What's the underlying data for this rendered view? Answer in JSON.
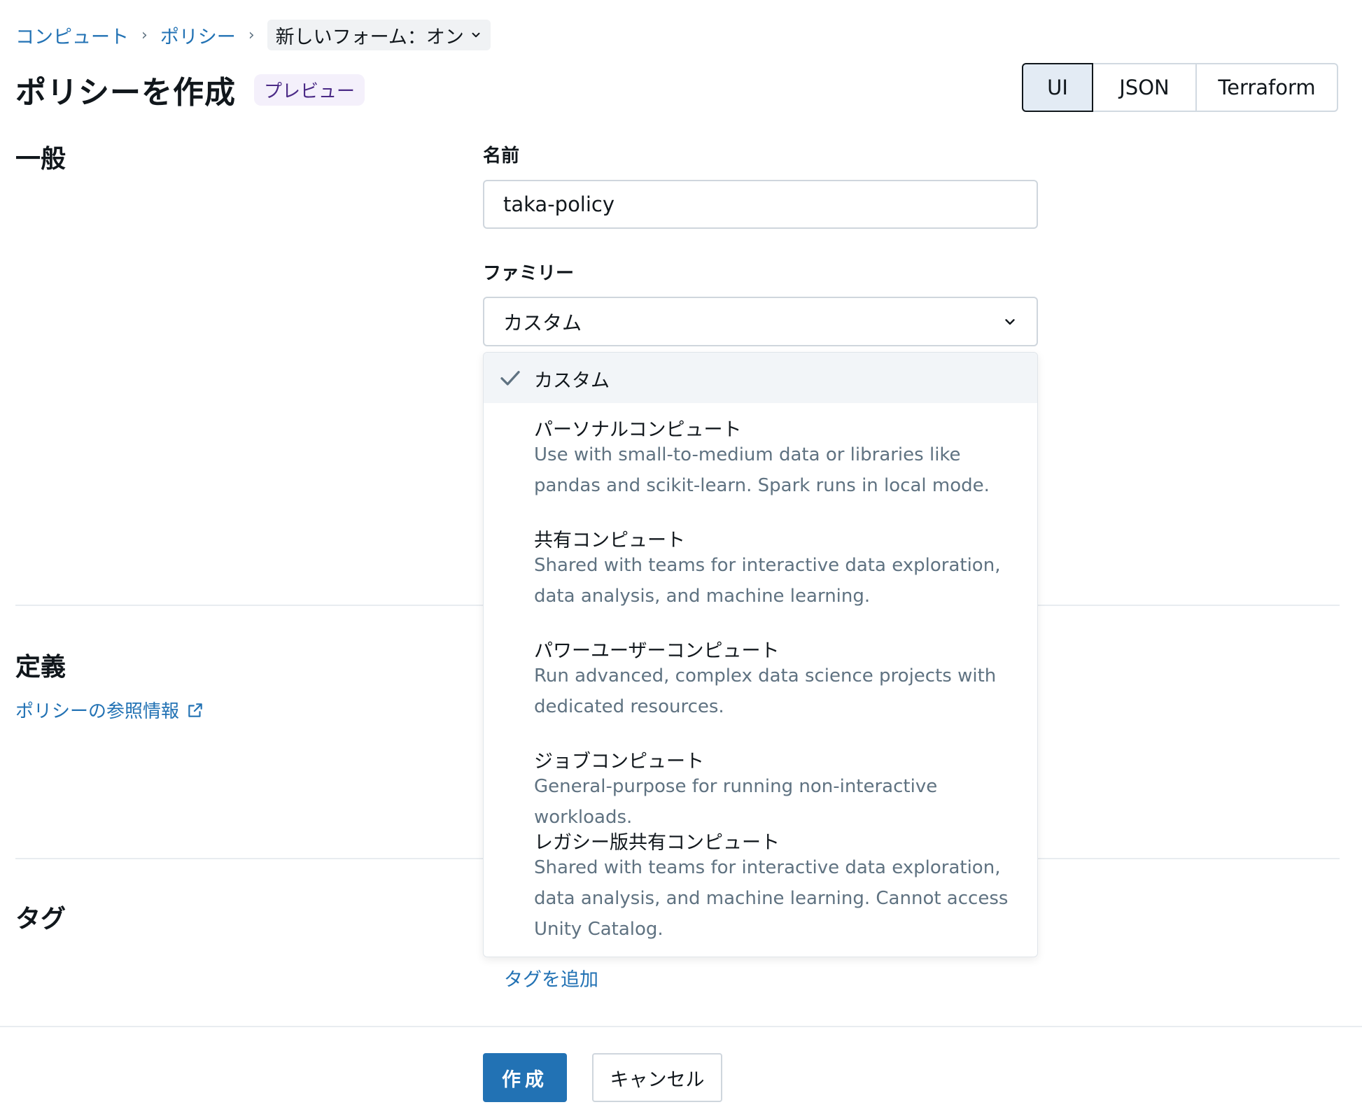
{
  "breadcrumb": {
    "items": [
      "コンピュート",
      "ポリシー"
    ],
    "current": "新しいフォーム：オン"
  },
  "header": {
    "title": "ポリシーを作成",
    "badge": "プレビュー",
    "view_tabs": [
      "UI",
      "JSON",
      "Terraform"
    ],
    "active_tab": "UI"
  },
  "sections": {
    "general": "一般",
    "definition": "定義",
    "definition_link": "ポリシーの参照情報",
    "tags": "タグ"
  },
  "form": {
    "name_label": "名前",
    "name_value": "taka-policy",
    "family_label": "ファミリー",
    "family_value": "カスタム"
  },
  "dropdown": {
    "options": [
      {
        "title": "カスタム",
        "desc": ""
      },
      {
        "title": "パーソナルコンピュート",
        "desc": "Use with small-to-medium data or libraries like pandas and scikit-learn. Spark runs in local mode."
      },
      {
        "title": "共有コンピュート",
        "desc": "Shared with teams for interactive data exploration, data analysis, and machine learning."
      },
      {
        "title": "パワーユーザーコンピュート",
        "desc": "Run advanced, complex data science projects with dedicated resources."
      },
      {
        "title": "ジョブコンピュート",
        "desc": "General-purpose for running non-interactive workloads."
      },
      {
        "title": "レガシー版共有コンピュート",
        "desc": "Shared with teams for interactive data exploration, data analysis, and machine learning. Cannot access Unity Catalog."
      }
    ]
  },
  "tags": {
    "add_label": "タグを追加"
  },
  "footer": {
    "create_label": "作成",
    "cancel_label": "キャンセル"
  },
  "colors": {
    "link": "#2272b4",
    "primary": "#2272b4",
    "muted_text": "#5f7281",
    "badge_bg": "#f4f0fb"
  }
}
